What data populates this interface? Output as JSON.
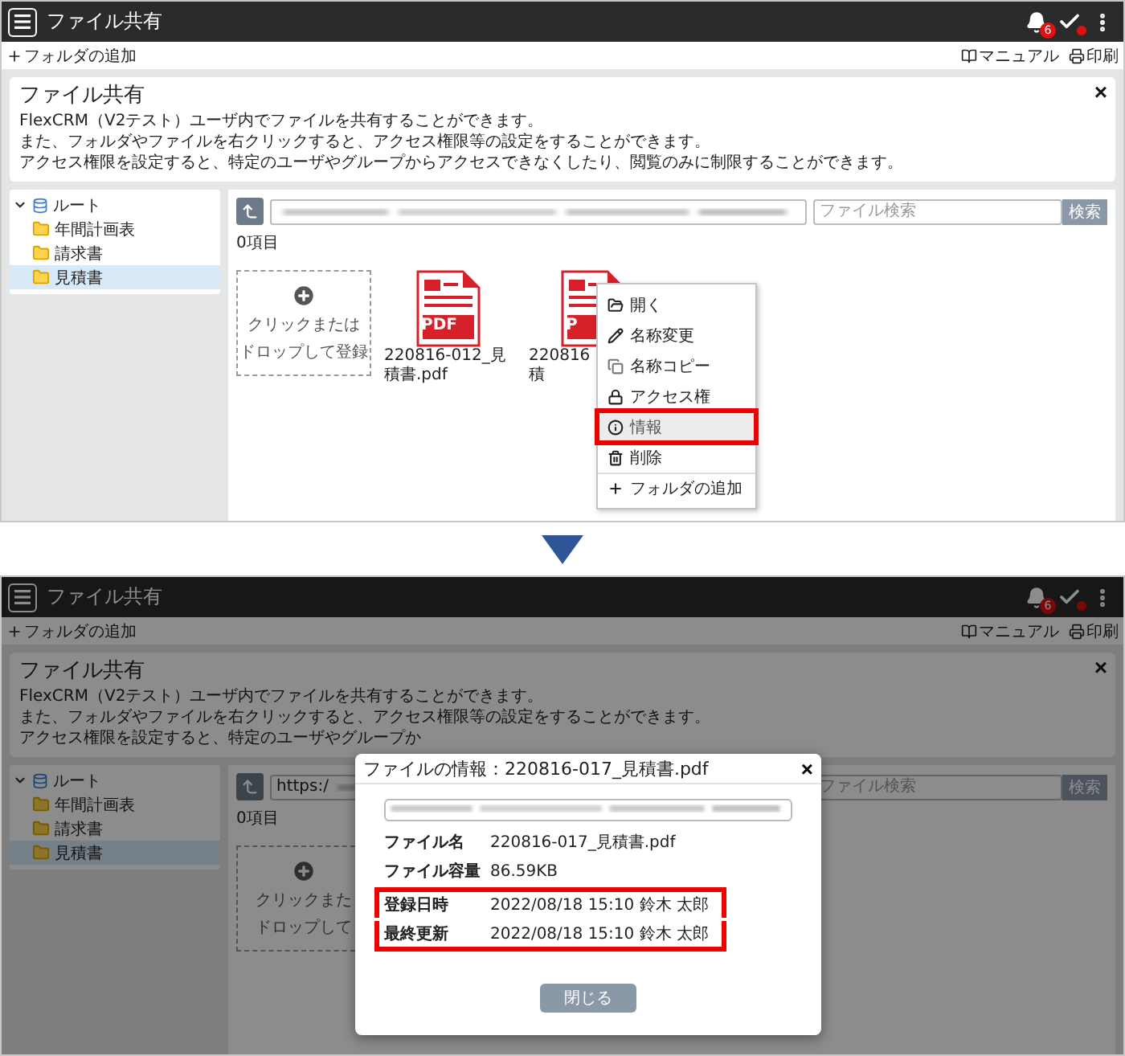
{
  "screens": [
    {
      "dimmed": false,
      "header": {
        "title": "ファイル共有",
        "badge": "6"
      },
      "toolbar": {
        "add_folder": "フォルダの追加",
        "manual": "マニュアル",
        "print": "印刷"
      },
      "info": {
        "title": "ファイル共有",
        "close": "×",
        "lines": [
          "FlexCRM（V2テスト）ユーザ内でファイルを共有することができます。",
          "また、フォルダやファイルを右クリックすると、アクセス権限等の設定をすることができます。",
          "アクセス権限を設定すると、特定のユーザやグループからアクセスできなくしたり、閲覧のみに制限することができます。"
        ]
      },
      "tree": {
        "label": "ルート",
        "expanded": true,
        "children": [
          {
            "label": "年間計画表",
            "selected": false
          },
          {
            "label": "請求書",
            "selected": false
          },
          {
            "label": "見積書",
            "selected": true
          }
        ]
      },
      "search": {
        "placeholder": "ファイル検索",
        "button": "検索"
      },
      "count": "0項目",
      "dropzone": [
        "クリックまたは",
        "ドロップして登録"
      ],
      "files": [
        {
          "type_label": "PDF",
          "name_lines": [
            "220816-012_見",
            "積書.pdf"
          ]
        },
        {
          "type_label": "P",
          "name_lines": [
            "220816",
            "積"
          ],
          "menu": [
            {
              "kind": "open",
              "label": "開く",
              "selected": false,
              "annotated": false
            },
            {
              "kind": "rename",
              "label": "名称変更",
              "selected": false,
              "annotated": false
            },
            {
              "kind": "copy",
              "label": "名称コピー",
              "selected": false,
              "annotated": false
            },
            {
              "kind": "access",
              "label": "アクセス権",
              "selected": false,
              "annotated": false
            },
            {
              "kind": "info",
              "label": "情報",
              "selected": true,
              "annotated": true
            },
            {
              "kind": "delete",
              "label": "削除",
              "selected": false,
              "annotated": false
            },
            {
              "kind": "add",
              "label": "フォルダの追加",
              "selected": false,
              "annotated": false
            }
          ]
        }
      ]
    },
    {
      "dimmed": true,
      "header": {
        "title": "ファイル共有",
        "badge": "6"
      },
      "toolbar": {
        "add_folder": "フォルダの追加",
        "manual": "マニュアル",
        "print": "印刷"
      },
      "info": {
        "title": "ファイル共有",
        "close": "×",
        "lines": [
          "FlexCRM（V2テスト）ユーザ内でファイルを共有することができます。",
          "また、フォルダやファイルを右クリックすると、アクセス権限等の設定をすることができます。",
          "アクセス権限を設定すると、特定のユーザやグループか"
        ]
      },
      "tree": {
        "label": "ルート",
        "expanded": true,
        "children": [
          {
            "label": "年間計画表",
            "selected": false
          },
          {
            "label": "請求書",
            "selected": false
          },
          {
            "label": "見積書",
            "selected": true
          }
        ]
      },
      "url_value": "https:/",
      "search": {
        "placeholder": "ファイル検索",
        "button": "検索"
      },
      "count": "0項目",
      "dropzone": [
        "クリックまた",
        "ドロップして"
      ],
      "modal": {
        "title": "ファイルの情報：220816-017_見積書.pdf",
        "close": "×",
        "button": "閉じる",
        "rows": [
          {
            "label": "ファイル名",
            "value": "220816-017_見積書.pdf",
            "annotated": false
          },
          {
            "label": "ファイル容量",
            "value": "86.59KB",
            "annotated": false
          },
          {
            "label": "登録日時",
            "value": "2022/08/18 15:10 鈴木 太郎",
            "annotated": true
          },
          {
            "label": "最終更新",
            "value": "2022/08/18 15:10 鈴木 太郎",
            "annotated": true
          }
        ]
      }
    }
  ]
}
